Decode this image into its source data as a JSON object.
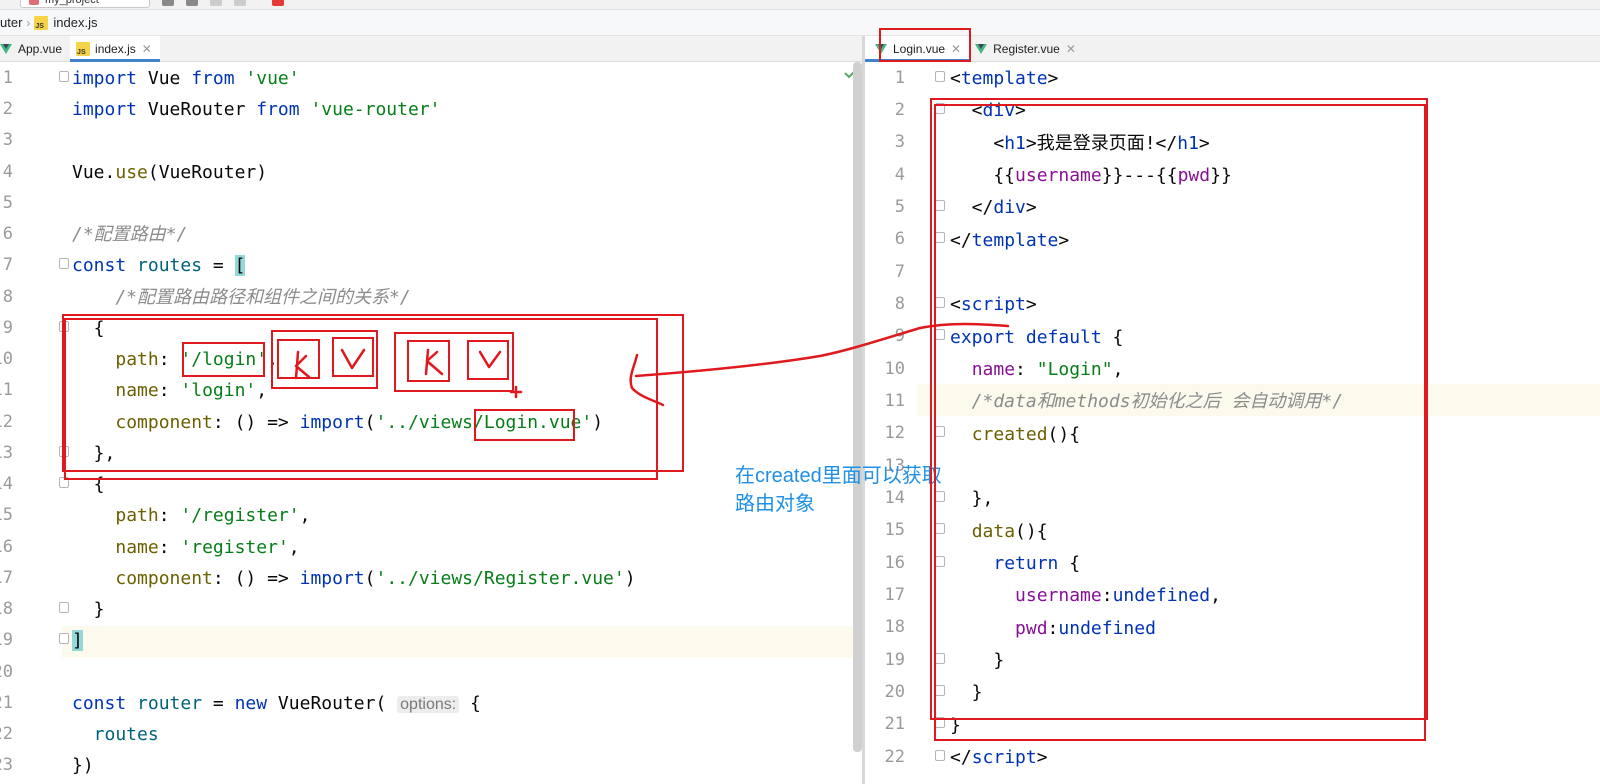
{
  "topbar": {
    "project_label": "my_project"
  },
  "breadcrumb": {
    "items": [
      "uter",
      "index.js"
    ]
  },
  "left_tabs": [
    {
      "label": "App.vue",
      "icon": "vue-icon"
    },
    {
      "label": "index.js",
      "icon": "js-icon",
      "active": true
    }
  ],
  "right_tabs": [
    {
      "label": "Login.vue",
      "icon": "vue-icon",
      "active": true
    },
    {
      "label": "Register.vue",
      "icon": "vue-icon"
    }
  ],
  "left_editor": {
    "line_numbers": [
      "1",
      "2",
      "3",
      "4",
      "5",
      "6",
      "7",
      "8",
      "9",
      "10",
      "11",
      "12",
      "13",
      "14",
      "15",
      "16",
      "17",
      "18",
      "19",
      "20",
      "21",
      "22",
      "23"
    ],
    "inlay_hint": "options:"
  },
  "right_editor": {
    "line_numbers": [
      "1",
      "2",
      "3",
      "4",
      "5",
      "6",
      "7",
      "8",
      "9",
      "10",
      "11",
      "12",
      "13",
      "14",
      "15",
      "16",
      "17",
      "18",
      "19",
      "20",
      "21",
      "22"
    ]
  },
  "annotation": {
    "line1": "在created里面可以获取",
    "line2": "路由对象"
  },
  "colors": {
    "annotation_red": "#e0191f",
    "annotation_blue": "#1e90e6",
    "accent": "#4083c9"
  }
}
